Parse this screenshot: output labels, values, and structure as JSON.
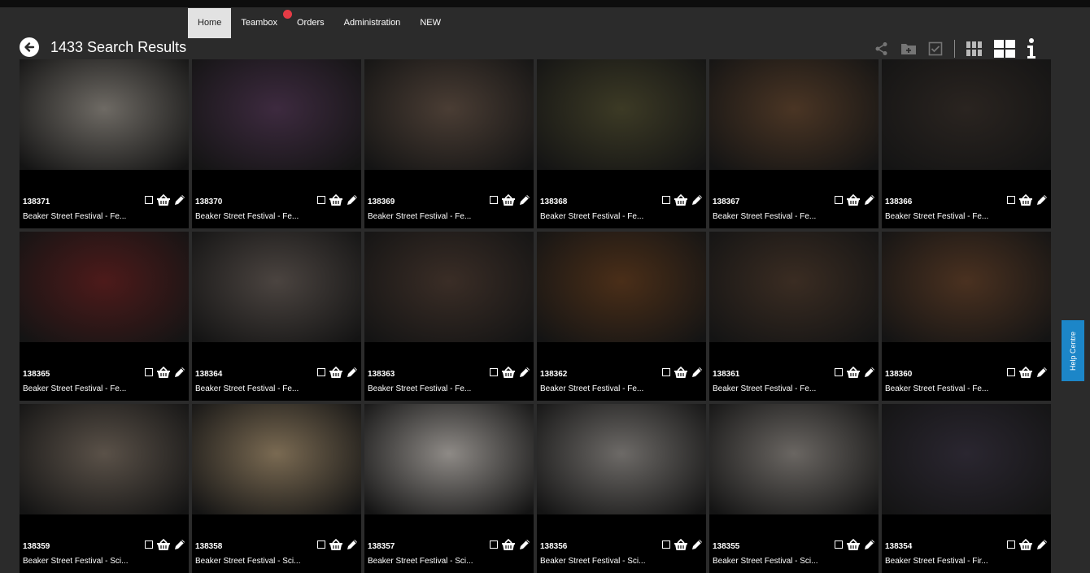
{
  "nav": {
    "items": [
      {
        "label": "Home",
        "active": true
      },
      {
        "label": "Teambox",
        "has_notification": true
      },
      {
        "label": "Orders"
      },
      {
        "label": "Administration"
      },
      {
        "label": "NEW"
      }
    ]
  },
  "header": {
    "title": "1433 Search Results",
    "toolbar_icons": [
      "share-icon",
      "add-to-folder-icon",
      "select-all-icon",
      "small-grid-icon",
      "large-grid-icon",
      "info-icon"
    ]
  },
  "help_tab": {
    "label": "Help Centre"
  },
  "colors": {
    "accent": "#1c86c8",
    "notification": "#e53b45",
    "background": "#2b2b2b"
  },
  "results": [
    {
      "id": "138371",
      "title": "Beaker Street Festival - Fe...",
      "tone": "#6e6a64"
    },
    {
      "id": "138370",
      "title": "Beaker Street Festival - Fe...",
      "tone": "#3d2a3f"
    },
    {
      "id": "138369",
      "title": "Beaker Street Festival - Fe...",
      "tone": "#4a3d34"
    },
    {
      "id": "138368",
      "title": "Beaker Street Festival - Fe...",
      "tone": "#3c3a25"
    },
    {
      "id": "138367",
      "title": "Beaker Street Festival - Fe...",
      "tone": "#4a3524"
    },
    {
      "id": "138366",
      "title": "Beaker Street Festival - Fe...",
      "tone": "#2a2420"
    },
    {
      "id": "138365",
      "title": "Beaker Street Festival - Fe...",
      "tone": "#4d1a1a"
    },
    {
      "id": "138364",
      "title": "Beaker Street Festival - Fe...",
      "tone": "#4b4440"
    },
    {
      "id": "138363",
      "title": "Beaker Street Festival - Fe...",
      "tone": "#3a2d26"
    },
    {
      "id": "138362",
      "title": "Beaker Street Festival - Fe...",
      "tone": "#4a2e18"
    },
    {
      "id": "138361",
      "title": "Beaker Street Festival - Fe...",
      "tone": "#3a2c22"
    },
    {
      "id": "138360",
      "title": "Beaker Street Festival - Fe...",
      "tone": "#4a3120"
    },
    {
      "id": "138359",
      "title": "Beaker Street Festival - Sci...",
      "tone": "#5a5148"
    },
    {
      "id": "138358",
      "title": "Beaker Street Festival - Sci...",
      "tone": "#7a6a52"
    },
    {
      "id": "138357",
      "title": "Beaker Street Festival - Sci...",
      "tone": "#8e8a86"
    },
    {
      "id": "138356",
      "title": "Beaker Street Festival - Sci...",
      "tone": "#6d6a67"
    },
    {
      "id": "138355",
      "title": "Beaker Street Festival - Sci...",
      "tone": "#6a6662"
    },
    {
      "id": "138354",
      "title": "Beaker Street Festival - Fir...",
      "tone": "#2a2630"
    }
  ]
}
